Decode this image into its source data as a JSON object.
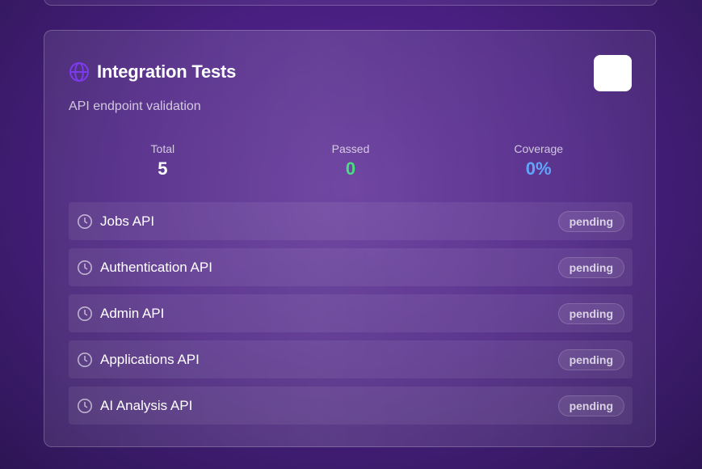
{
  "card": {
    "title": "Integration Tests",
    "subtitle": "API endpoint validation",
    "icon": "globe-icon",
    "action_button_label": ""
  },
  "stats": [
    {
      "label": "Total",
      "value": "5",
      "color": "#ffffff"
    },
    {
      "label": "Passed",
      "value": "0",
      "color": "#4ade80"
    },
    {
      "label": "Coverage",
      "value": "0%",
      "color": "#60a5fa"
    }
  ],
  "tests": [
    {
      "name": "Jobs API",
      "status": "pending",
      "icon": "clock-icon"
    },
    {
      "name": "Authentication API",
      "status": "pending",
      "icon": "clock-icon"
    },
    {
      "name": "Admin API",
      "status": "pending",
      "icon": "clock-icon"
    },
    {
      "name": "Applications API",
      "status": "pending",
      "icon": "clock-icon"
    },
    {
      "name": "AI Analysis API",
      "status": "pending",
      "icon": "clock-icon"
    }
  ],
  "colors": {
    "accent_icon": "#7c3aed",
    "passed": "#4ade80",
    "coverage": "#60a5fa"
  }
}
